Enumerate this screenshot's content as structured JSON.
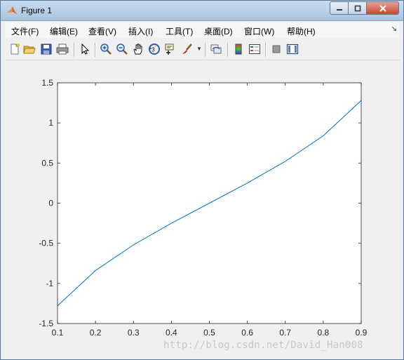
{
  "window": {
    "title": "Figure 1"
  },
  "menu": [
    {
      "label": "文件(F)"
    },
    {
      "label": "编辑(E)"
    },
    {
      "label": "查看(V)"
    },
    {
      "label": "插入(I)"
    },
    {
      "label": "工具(T)"
    },
    {
      "label": "桌面(D)"
    },
    {
      "label": "窗口(W)"
    },
    {
      "label": "帮助(H)"
    }
  ],
  "toolbar": [
    "new-figure-icon",
    "open-file-icon",
    "save-icon",
    "print-icon",
    "edit-plot-arrow-icon",
    "zoom-in-icon",
    "zoom-out-icon",
    "pan-hand-icon",
    "rotate-3d-icon",
    "data-cursor-icon",
    "brush-icon",
    "link-plot-icon",
    "colorbar-icon",
    "legend-icon",
    "hide-plot-tools-icon",
    "show-plot-tools-icon"
  ],
  "watermark": "http://blog.csdn.net/David_Han008",
  "chart_data": {
    "type": "line",
    "x": [
      0.1,
      0.2,
      0.3,
      0.4,
      0.5,
      0.6,
      0.7,
      0.8,
      0.9
    ],
    "series": [
      {
        "values": [
          -1.28,
          -0.84,
          -0.52,
          -0.25,
          0.0,
          0.25,
          0.52,
          0.84,
          1.28
        ],
        "color": "#0072bd"
      }
    ],
    "xlim": [
      0.1,
      0.9
    ],
    "ylim": [
      -1.5,
      1.5
    ],
    "xticks": [
      "0.1",
      "0.2",
      "0.3",
      "0.4",
      "0.5",
      "0.6",
      "0.7",
      "0.8",
      "0.9"
    ],
    "yticks": [
      "1.5",
      "1",
      "0.5",
      "0",
      "-0.5",
      "-1",
      "-1.5"
    ],
    "grid": false
  }
}
